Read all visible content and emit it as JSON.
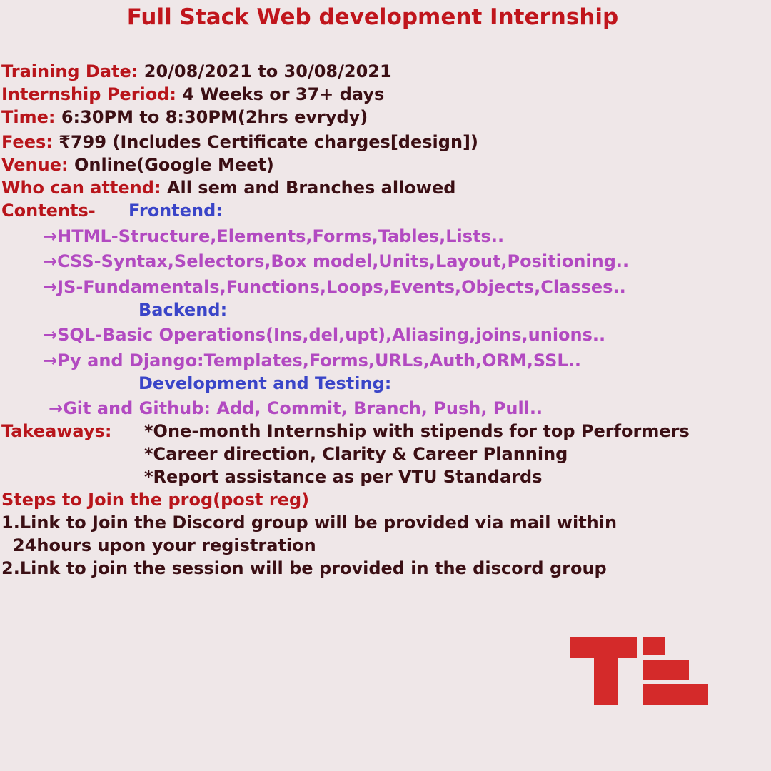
{
  "title": "Full Stack Web development Internship",
  "details": [
    {
      "label": "Training Date:",
      "value": "20/08/2021 to 30/08/2021"
    },
    {
      "label": "Internship Period:",
      "value": "4 Weeks or 37+ days"
    },
    {
      "label": "Time:",
      "value": "6:30PM to 8:30PM(2hrs evrydy)"
    },
    {
      "label": "Fees:",
      "value": "₹799 (Includes Certificate charges[design])"
    },
    {
      "label": "Venue:",
      "value": "Online(Google Meet)"
    },
    {
      "label": "Who can attend:",
      "value": "All sem and Branches allowed"
    }
  ],
  "contents": {
    "label": "Contents-",
    "frontend": {
      "heading": "Frontend:",
      "items": [
        "→HTML-Structure,Elements,Forms,Tables,Lists..",
        "→CSS-Syntax,Selectors,Box model,Units,Layout,Positioning..",
        "→JS-Fundamentals,Functions,Loops,Events,Objects,Classes.."
      ]
    },
    "backend": {
      "heading": "Backend:",
      "items": [
        "→SQL-Basic Operations(Ins,del,upt),Aliasing,joins,unions..",
        "→Py and Django:Templates,Forms,URLs,Auth,ORM,SSL.."
      ]
    },
    "devtest": {
      "heading": "Development and Testing:",
      "items": [
        "→Git and Github: Add, Commit, Branch, Push, Pull.."
      ]
    }
  },
  "takeaways": {
    "label": "Takeaways:",
    "items": [
      "*One-month Internship with stipends for top Performers",
      "*Career direction, Clarity & Career Planning",
      "*Report assistance as per VTU Standards"
    ]
  },
  "steps": {
    "heading": "Steps to Join the prog(post reg)",
    "step1_line1": "1.Link to Join the Discord group will be provided via mail within",
    "step1_line2": "24hours upon your registration",
    "step2": "2.Link to join the session will be provided in the discord group"
  },
  "logo": {
    "name": "tl-logo",
    "color": "#d42a2a"
  }
}
